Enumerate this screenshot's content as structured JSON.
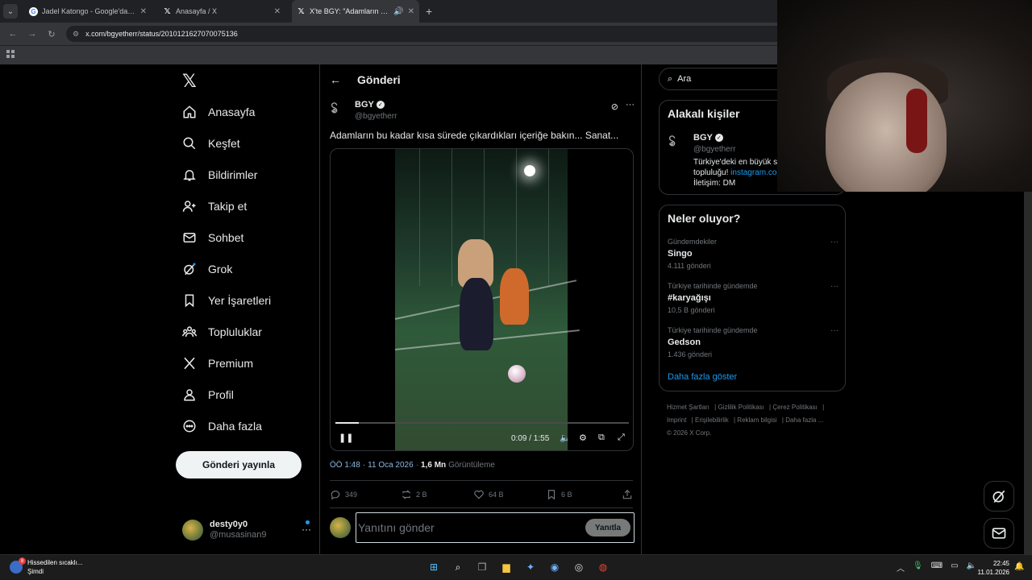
{
  "browser": {
    "tabs": [
      {
        "title": "Jadel Katongo - Google'da Ara",
        "icon": "google-icon",
        "active": false
      },
      {
        "title": "Anasayfa / X",
        "icon": "x-icon",
        "active": false
      },
      {
        "title": "X'te BGY: \"Adamların bu ka",
        "icon": "x-icon",
        "active": true
      }
    ],
    "url": "x.com/bgyetherr/status/2010121627070075136"
  },
  "nav": {
    "items": [
      {
        "label": "Anasayfa",
        "icon": "home-icon"
      },
      {
        "label": "Keşfet",
        "icon": "search-icon"
      },
      {
        "label": "Bildirimler",
        "icon": "bell-icon"
      },
      {
        "label": "Takip et",
        "icon": "follow-icon"
      },
      {
        "label": "Sohbet",
        "icon": "mail-icon"
      },
      {
        "label": "Grok",
        "icon": "grok-icon"
      },
      {
        "label": "Yer İşaretleri",
        "icon": "bookmark-icon"
      },
      {
        "label": "Topluluklar",
        "icon": "communities-icon"
      },
      {
        "label": "Premium",
        "icon": "x-icon"
      },
      {
        "label": "Profil",
        "icon": "person-icon"
      },
      {
        "label": "Daha fazla",
        "icon": "more-circle-icon"
      }
    ],
    "post_button": "Gönderi yayınla",
    "me": {
      "name": "desty0y0",
      "handle": "@musasinan9"
    }
  },
  "main": {
    "title": "Gönderi",
    "author": {
      "name": "BGY",
      "handle": "@bgyetherr"
    },
    "text": "Adamların bu kadar kısa sürede çıkardıkları içeriğe bakın... Sanat...",
    "video": {
      "time": "0:09 / 1:55",
      "progress": 0.08
    },
    "meta": {
      "time": "ÖÖ 1:48",
      "date": "11 Oca 2026",
      "views": "1,6 Mn",
      "views_label": "Görüntüleme"
    },
    "actions": {
      "replies": "349",
      "reposts": "2 B",
      "likes": "64 B",
      "bookmarks": "6 B"
    },
    "reply": {
      "placeholder": "Yanıtını gönder",
      "button": "Yanıtla"
    }
  },
  "right": {
    "search_placeholder": "Ara",
    "relevant_title": "Alakalı kişiler",
    "relevant": {
      "name": "BGY",
      "handle": "@bgyetherr",
      "bio1": "Türkiye'deki en büyük s",
      "bio2": "topluluğu! ",
      "bio_link": "instagram.co",
      "bio3": "İletişim: DM"
    },
    "trends_title": "Neler oluyor?",
    "trends": [
      {
        "context": "Gündemdekiler",
        "name": "Singo",
        "count": "4.111 gönderi"
      },
      {
        "context": "Türkiye tarihinde gündemde",
        "name": "#karyağışı",
        "count": "10,5 B gönderi"
      },
      {
        "context": "Türkiye tarihinde gündemde",
        "name": "Gedson",
        "count": "1.436 gönderi"
      }
    ],
    "show_more": "Daha fazla göster",
    "footer_links": [
      "Hizmet Şartları",
      "Gizlilik Politikası",
      "Çerez Politikası",
      "Imprint",
      "Erişilebilirlik",
      "Reklam bilgisi",
      "Daha fazla ..."
    ],
    "copyright": "© 2026 X Corp."
  },
  "taskbar": {
    "weather_line1": "Hissedilen sıcaklı...",
    "weather_line2": "Şimdi",
    "weather_badge": "8",
    "time": "22:45",
    "date": "11.01.2026"
  }
}
